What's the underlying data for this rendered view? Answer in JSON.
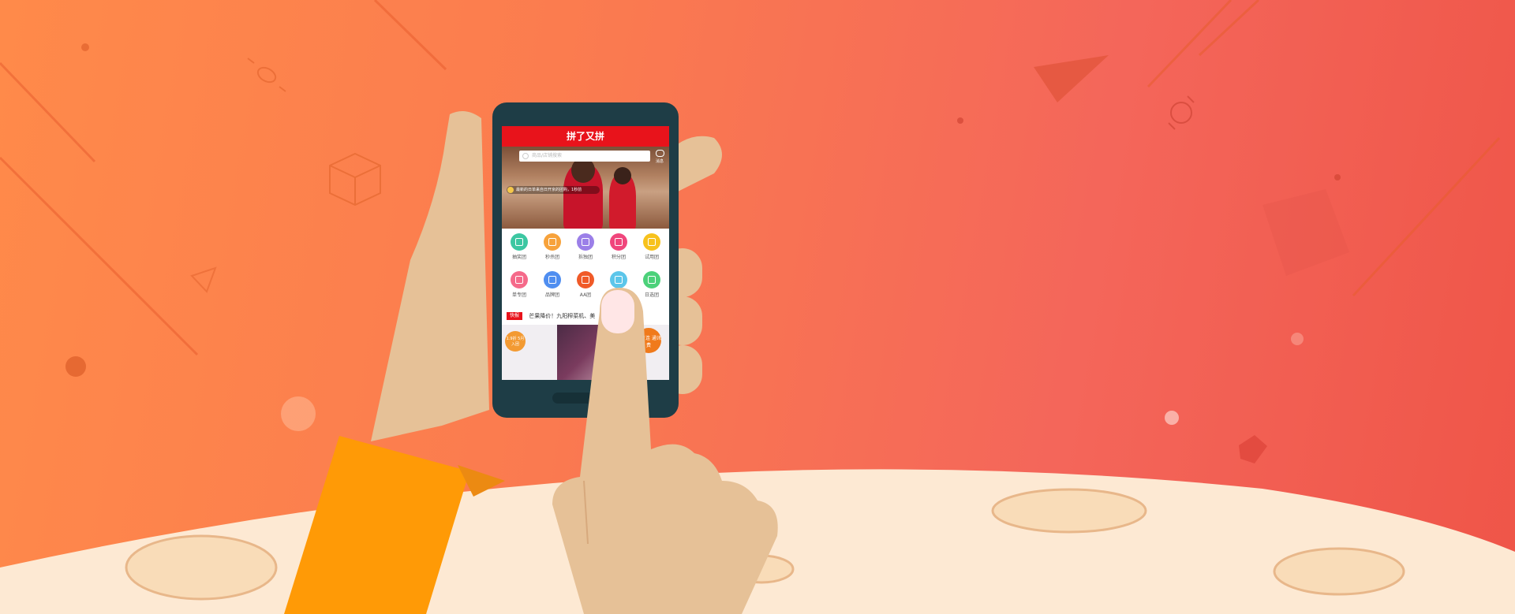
{
  "app": {
    "title": "拼了又拼",
    "search_placeholder": "商品/店铺搜索",
    "message_label": "消息",
    "notice_text": "最新的日单来自日开京的团购，1秒前",
    "categories": [
      {
        "label": "抽奖团",
        "color": "#3cc7a2",
        "icon": "gift-icon"
      },
      {
        "label": "秒杀团",
        "color": "#f7a23b",
        "icon": "flash-icon"
      },
      {
        "label": "拆独团",
        "color": "#9b7fe8",
        "icon": "link-icon"
      },
      {
        "label": "积分团",
        "color": "#f0467c",
        "icon": "coin-icon"
      },
      {
        "label": "试用团",
        "color": "#f7c21d",
        "icon": "trial-icon"
      },
      {
        "label": "单专团",
        "color": "#f56a8a",
        "icon": "gift-box-icon"
      },
      {
        "label": "品牌团",
        "color": "#4f8ef0",
        "icon": "brand-icon"
      },
      {
        "label": "AA团",
        "color": "#f05a28",
        "icon": "aa-icon"
      },
      {
        "label": "",
        "color": "#5cc6ea",
        "icon": "palette-icon"
      },
      {
        "label": "日选团",
        "color": "#4cd17a",
        "icon": "plus-icon"
      }
    ],
    "news_tag": "快报",
    "news_text": "芒果降价！九阳榨菜机、美",
    "promo_left": "1.9折 5月入团",
    "promo_right": "多月连 通讯费"
  },
  "colors": {
    "brand_red": "#e8131b",
    "bg_orange": "#fb7c4f",
    "bg_red": "#ef5548",
    "phone_body": "#1e3d46",
    "skin": "#e6c197",
    "sleeve": "#ff9a06",
    "ground": "#fde9d3"
  }
}
